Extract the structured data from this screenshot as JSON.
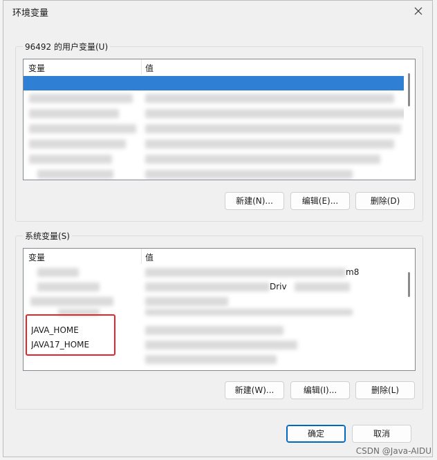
{
  "window": {
    "title": "环境变量"
  },
  "user_vars": {
    "group_label": "96492 的用户变量(U)",
    "columns": [
      "变量",
      "值"
    ],
    "buttons": {
      "new": "新建(N)...",
      "edit": "编辑(E)...",
      "delete": "删除(D)"
    }
  },
  "system_vars": {
    "group_label": "系统变量(S)",
    "columns": [
      "变量",
      "值"
    ],
    "rows": [
      {
        "name": "",
        "value": "m8"
      },
      {
        "name": "",
        "value": "Driv"
      },
      {
        "name": "",
        "value": ""
      },
      {
        "name": "",
        "value": ""
      },
      {
        "name": "JAVA_HOME",
        "value": ""
      },
      {
        "name": "JAVA17_HOME",
        "value": ""
      }
    ],
    "buttons": {
      "new": "新建(W)...",
      "edit": "编辑(I)...",
      "delete": "删除(L)"
    }
  },
  "footer": {
    "ok": "确定",
    "cancel": "取消"
  },
  "watermark": "CSDN @Java-AIDU",
  "colors": {
    "selection": "#2f7fd4",
    "highlight": "#e3242b",
    "primary_border": "#0067c0"
  }
}
